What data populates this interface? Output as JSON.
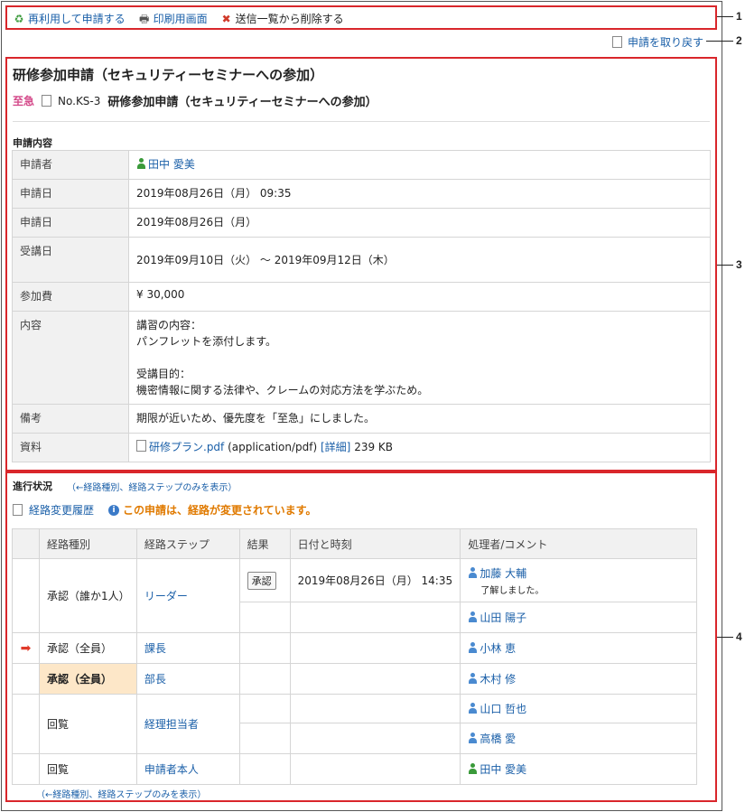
{
  "toolbar": {
    "reuse": "再利用して申請する",
    "print": "印刷用画面",
    "delete": "送信一覧から削除する"
  },
  "withdraw": "申請を取り戻す",
  "title": "研修参加申請（セキュリティーセミナーへの参加）",
  "subtitle": {
    "priority": "至急",
    "number": "No.KS-3",
    "title": "研修参加申請（セキュリティーセミナーへの参加）"
  },
  "section_label": "申請内容",
  "detail": {
    "applicant_label": "申請者",
    "applicant": "田中 愛美",
    "applied_datetime_label": "申請日",
    "applied_datetime": "2019年08月26日（月） 09:35",
    "applied_date_label": "申請日",
    "applied_date": "2019年08月26日（月）",
    "course_date_label": "受講日",
    "course_date": "2019年09月10日（火） ～ 2019年09月12日（木）",
    "fee_label": "参加費",
    "fee": "¥ 30,000",
    "content_label": "内容",
    "content_line1": "講習の内容：",
    "content_line2": "パンフレットを添付します。",
    "content_line3": "受講目的：",
    "content_line4": "機密情報に関する法律や、クレームの対応方法を学ぶため。",
    "note_label": "備考",
    "note": "期限が近いため、優先度を「至急」にしました。",
    "file_label": "資料",
    "file_name": "研修プラン.pdf",
    "file_type": "(application/pdf)",
    "file_detail": "[詳細]",
    "file_size": "239 KB"
  },
  "progress": {
    "label": "進行状況",
    "toggle_link": "（←経路種別、経路ステップのみを表示）",
    "history": "経路変更履歴",
    "info": "この申請は、経路が変更されています。"
  },
  "route": {
    "headers": [
      "経路種別",
      "経路ステップ",
      "結果",
      "日付と時刻",
      "処理者/コメント"
    ],
    "r1_type": "承認（誰か1人）",
    "r1_step": "リーダー",
    "r1_result": "承認",
    "r1_datetime": "2019年08月26日（月） 14:35",
    "r1_person1": "加藤 大輔",
    "r1_comment": "了解しました。",
    "r1_person2": "山田 陽子",
    "r2_type": "承認（全員）",
    "r2_step": "課長",
    "r2_person": "小林 恵",
    "r3_type": "承認（全員）",
    "r3_step": "部長",
    "r3_person": "木村 修",
    "r4_type": "回覧",
    "r4_step": "経理担当者",
    "r4_person1": "山口 哲也",
    "r4_person2": "高橋 愛",
    "r5_type": "回覧",
    "r5_step": "申請者本人",
    "r5_person": "田中 愛美"
  },
  "toggle_link_bottom": "（←経路種別、経路ステップのみを表示）",
  "callouts": [
    "1",
    "2",
    "3",
    "4"
  ]
}
